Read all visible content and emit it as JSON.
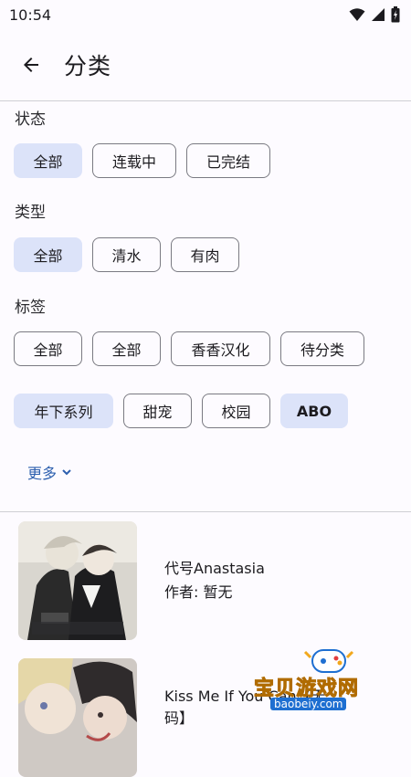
{
  "status_bar": {
    "time": "10:54"
  },
  "app_bar": {
    "title": "分类"
  },
  "filters": {
    "status": {
      "label": "状态",
      "options": [
        "全部",
        "连载中",
        "已完结"
      ],
      "selected": 0
    },
    "type": {
      "label": "类型",
      "options": [
        "全部",
        "清水",
        "有肉"
      ],
      "selected": 0
    },
    "tags": {
      "label": "标签",
      "row1": [
        "全部",
        "全部",
        "香香汉化",
        "待分类"
      ],
      "row2": [
        "年下系列",
        "甜宠",
        "校园",
        "ABO"
      ]
    },
    "more_label": "更多"
  },
  "list": [
    {
      "title": "代号Anastasia",
      "author": "作者: 暂无"
    },
    {
      "title": "Kiss Me If You Can【无",
      "title_line2": "码】"
    }
  ],
  "watermark": {
    "text": "宝贝游戏网",
    "sub": "baobeiy.com"
  },
  "colors": {
    "accent": "#2c5fae",
    "chip_selected": "#dce3f9",
    "background": "#fdfbff"
  }
}
